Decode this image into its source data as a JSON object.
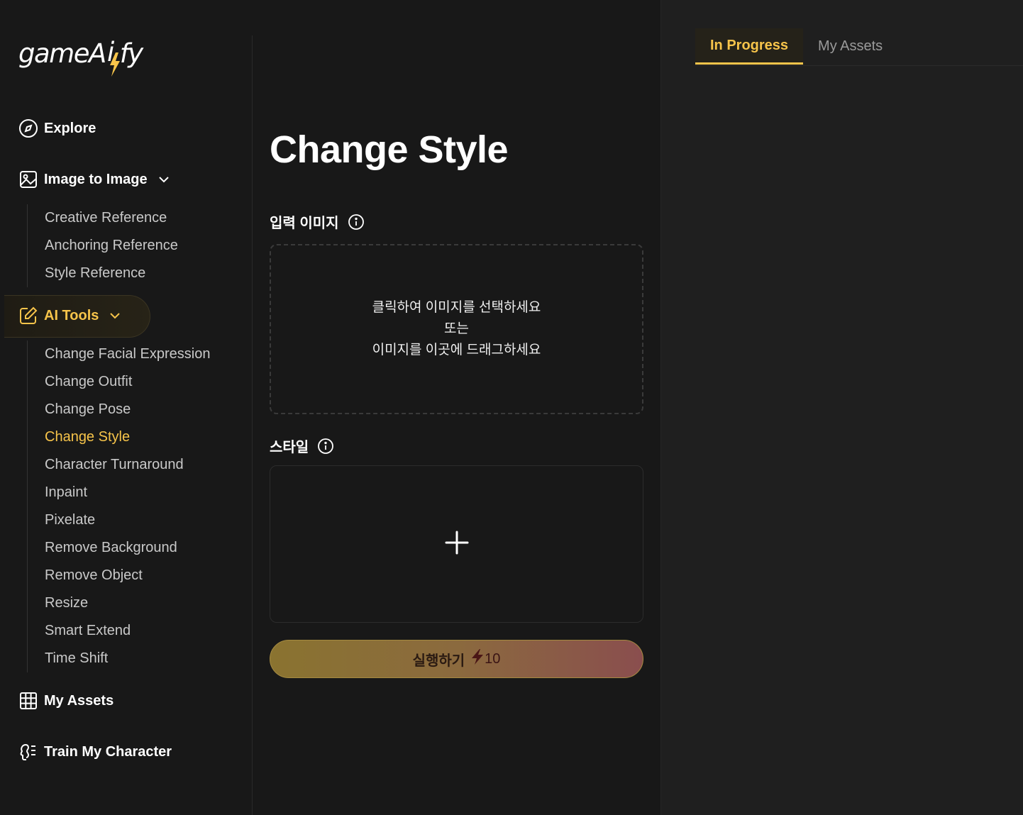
{
  "brand": {
    "logo_left": "gameA",
    "logo_right": "fy",
    "accent": "#f7c44a"
  },
  "sidebar": {
    "explore": {
      "label": "Explore",
      "icon": "compass-icon"
    },
    "image_to_image": {
      "label": "Image to Image",
      "icon": "image-icon",
      "items": [
        "Creative Reference",
        "Anchoring Reference",
        "Style Reference"
      ]
    },
    "ai_tools": {
      "label": "AI Tools",
      "icon": "edit-icon",
      "items": [
        "Change Facial Expression",
        "Change Outfit",
        "Change Pose",
        "Change Style",
        "Character Turnaround",
        "Inpaint",
        "Pixelate",
        "Remove Background",
        "Remove Object",
        "Resize",
        "Smart Extend",
        "Time Shift"
      ],
      "active_item": "Change Style"
    },
    "my_assets": {
      "label": "My Assets",
      "icon": "grid-icon"
    },
    "train": {
      "label": "Train My Character",
      "icon": "character-icon"
    }
  },
  "main": {
    "title": "Change Style",
    "input_image": {
      "label": "입력 이미지",
      "line1": "클릭하여 이미지를 선택하세요",
      "line2": "또는",
      "line3": "이미지를 이곳에 드래그하세요"
    },
    "style": {
      "label": "스타일"
    },
    "run": {
      "label": "실행하기",
      "cost": "10"
    }
  },
  "right_panel": {
    "tabs": [
      "In Progress",
      "My Assets"
    ],
    "active_tab": "In Progress"
  }
}
